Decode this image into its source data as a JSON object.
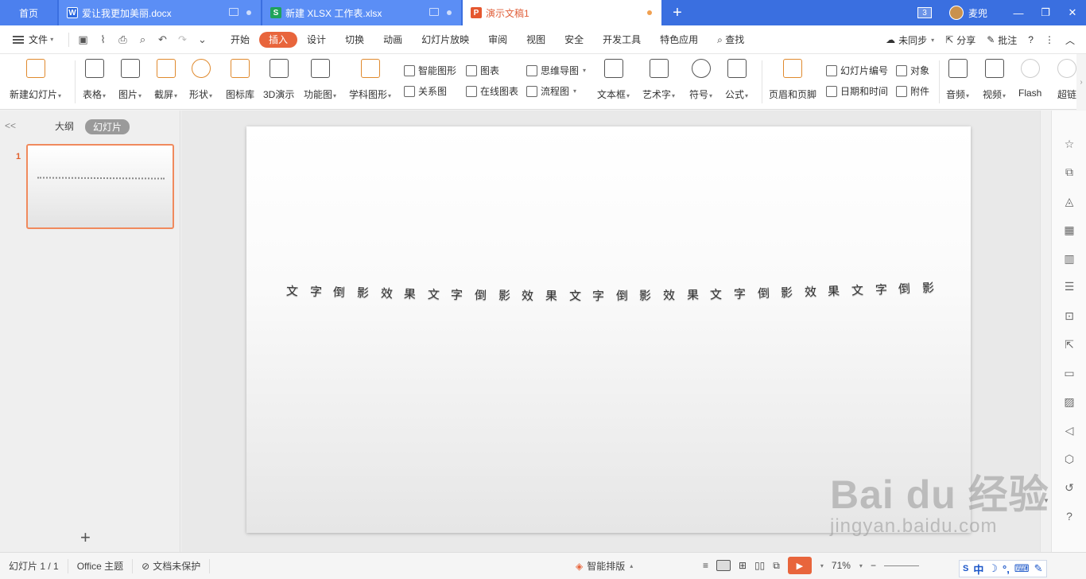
{
  "tabs": [
    {
      "label": "首页",
      "type": "home"
    },
    {
      "label": "爱让我更加美丽.docx",
      "type": "doc",
      "icon": "W"
    },
    {
      "label": "新建 XLSX 工作表.xlsx",
      "type": "xls",
      "icon": "S"
    },
    {
      "label": "演示文稿1",
      "type": "ppt",
      "icon": "P",
      "active": true
    }
  ],
  "titlebar": {
    "add_tab": "+",
    "window_count": "3",
    "user": "麦兜"
  },
  "menubar": {
    "file": "文件",
    "items": [
      "开始",
      "插入",
      "设计",
      "切换",
      "动画",
      "幻灯片放映",
      "审阅",
      "视图",
      "安全",
      "开发工具",
      "特色应用"
    ],
    "active": "插入",
    "search": "查找",
    "sync": "未同步",
    "share": "分享",
    "comment": "批注",
    "help": "?"
  },
  "ribbon": {
    "new_slide": "新建幻灯片",
    "table": "表格",
    "picture": "图片",
    "screenshot": "截屏",
    "shape": "形状",
    "icon_lib": "图标库",
    "demo_3d": "3D演示",
    "func_chart": "功能图",
    "subject_shape": "学科图形",
    "smart_shape": "智能图形",
    "relation": "关系图",
    "chart": "图表",
    "online_chart": "在线图表",
    "mindmap": "思维导图",
    "flowchart": "流程图",
    "textbox": "文本框",
    "wordart": "艺术字",
    "symbol": "符号",
    "formula": "公式",
    "header_footer": "页眉和页脚",
    "slide_number": "幻灯片编号",
    "datetime": "日期和时间",
    "object": "对象",
    "attachment": "附件",
    "audio": "音频",
    "video": "视频",
    "flash": "Flash",
    "super": "超链"
  },
  "leftpanel": {
    "outline_tab": "大纲",
    "slides_tab": "幻灯片",
    "slide_number": "1",
    "add": "+",
    "collapse": "<<"
  },
  "slide": {
    "chars": [
      "文",
      "字",
      "倒",
      "影",
      "效",
      "果",
      "文",
      "字",
      "倒",
      "影",
      "效",
      "果",
      "文",
      "字",
      "倒",
      "影",
      "效",
      "果",
      "文",
      "字",
      "倒",
      "影",
      "效",
      "果",
      "文",
      "字",
      "倒",
      "影"
    ]
  },
  "statusbar": {
    "slide_info": "幻灯片 1 / 1",
    "theme": "Office 主题",
    "protect": "文档未保护",
    "smart_layout": "智能排版",
    "zoom": "71%",
    "zoom_minus": "−"
  },
  "watermark": {
    "top": "Bai du 经验",
    "bottom": "jingyan.baidu.com"
  },
  "ime": {
    "lang": "中",
    "moon": "☽"
  },
  "colors": {
    "tabbar": "#3a6fe0",
    "accent": "#e8653c",
    "ppt_tab_text": "#e05f3a"
  }
}
